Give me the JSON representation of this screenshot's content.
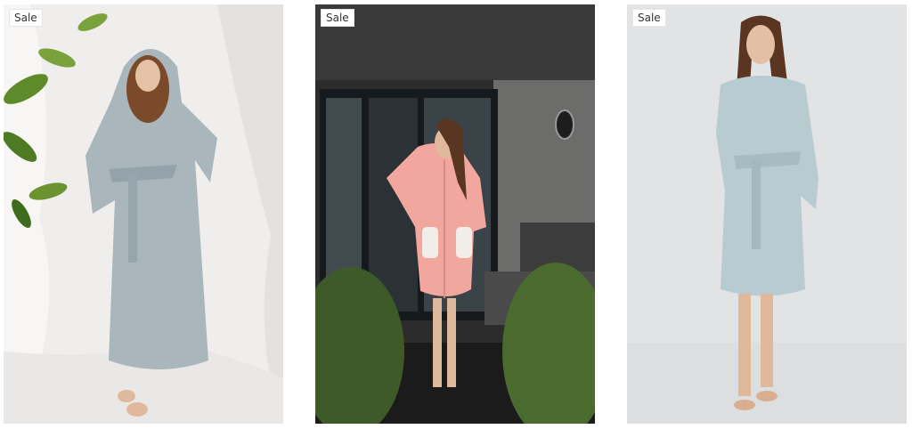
{
  "products": [
    {
      "badge": "Sale",
      "image_icon": "product-photo-light-blue-long-hooded-robe",
      "colors": {
        "background": "#ecebe9",
        "robe": "#a9b6bb",
        "accent": "#5e8a2c"
      }
    },
    {
      "badge": "Sale",
      "image_icon": "product-photo-pink-zip-hooded-robe",
      "colors": {
        "background": "#2b2b2b",
        "robe": "#f2a79e",
        "accent": "#3f5a2a"
      }
    },
    {
      "badge": "Sale",
      "image_icon": "product-photo-light-blue-short-hooded-robe",
      "colors": {
        "background": "#e3e4e6",
        "robe": "#b8cbd1",
        "accent": "#6b3f2a"
      }
    }
  ]
}
